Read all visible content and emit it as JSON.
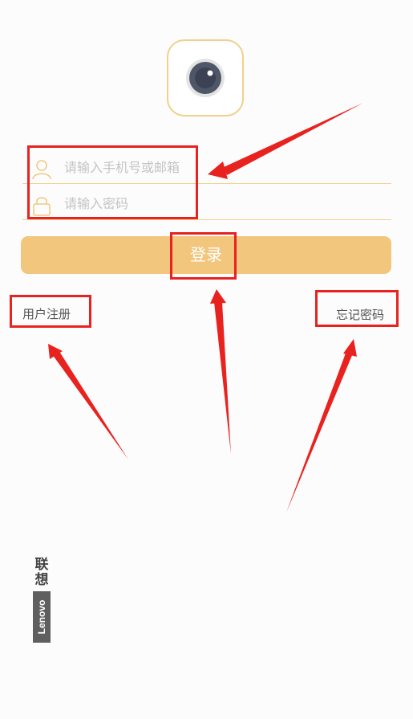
{
  "account_field": {
    "placeholder": "请输入手机号或邮箱",
    "value": "",
    "icon": "user-icon"
  },
  "password_field": {
    "placeholder": "请输入密码",
    "value": "",
    "icon": "lock-icon"
  },
  "login_button": {
    "label": "登录"
  },
  "register_link": {
    "label": "用户注册"
  },
  "forgot_link": {
    "label": "忘记密码"
  },
  "app_logo": {
    "icon": "camera-lens-icon"
  },
  "brand": {
    "cn_1": "联",
    "cn_2": "想",
    "en": "Lenovo"
  },
  "colors": {
    "accent": "#f2c67c",
    "field_border": "#f0d28c",
    "annotation": "#e8221f"
  }
}
